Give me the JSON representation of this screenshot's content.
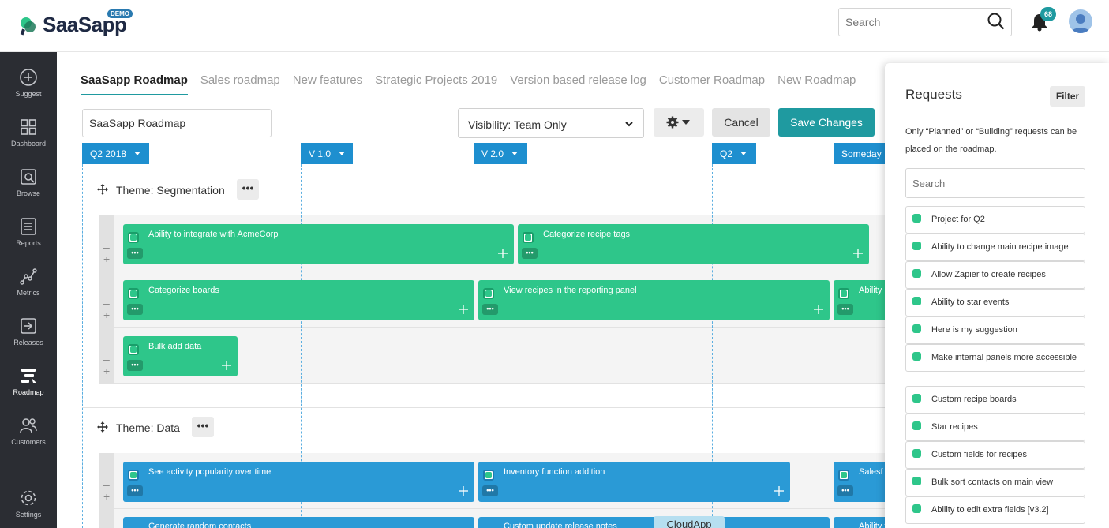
{
  "app": {
    "logo_text": "SaaSapp",
    "demo_badge": "DEMO"
  },
  "header": {
    "search_placeholder": "Search",
    "notification_count": "68"
  },
  "sidebar": {
    "items": [
      {
        "label": "Suggest",
        "icon": "plus-circle-icon"
      },
      {
        "label": "Dashboard",
        "icon": "grid-icon"
      },
      {
        "label": "Browse",
        "icon": "browse-icon"
      },
      {
        "label": "Reports",
        "icon": "reports-icon"
      },
      {
        "label": "Metrics",
        "icon": "metrics-icon"
      },
      {
        "label": "Releases",
        "icon": "releases-icon"
      },
      {
        "label": "Roadmap",
        "icon": "roadmap-icon",
        "active": true
      },
      {
        "label": "Customers",
        "icon": "customers-icon"
      },
      {
        "label": "Settings",
        "icon": "gear-icon"
      }
    ]
  },
  "tabs": [
    "SaaSapp Roadmap",
    "Sales roadmap",
    "New features",
    "Strategic Projects 2019",
    "Version based release log",
    "Customer Roadmap",
    "New Roadmap"
  ],
  "toolbar": {
    "roadmap_name": "SaaSapp Roadmap",
    "visibility": "Visibility: Team Only",
    "cancel_label": "Cancel",
    "save_label": "Save Changes"
  },
  "milestones": [
    "Q2 2018",
    "V 1.0",
    "V 2.0",
    "Q2",
    "Someday"
  ],
  "themes": [
    {
      "title": "Theme: Segmentation",
      "rows": [
        [
          "Ability to integrate with AcmeCorp",
          "Categorize recipe tags"
        ],
        [
          "Categorize boards",
          "View recipes in the reporting panel",
          "Ability"
        ],
        [
          "Bulk add data"
        ]
      ]
    },
    {
      "title": "Theme: Data",
      "rows": [
        [
          "See activity popularity over time",
          "Inventory function addition",
          "Salesf"
        ],
        [
          "Generate random contacts",
          "Custom update release notes",
          "Ability to export all recipes to CSV"
        ]
      ]
    }
  ],
  "requests_panel": {
    "title": "Requests",
    "filter_label": "Filter",
    "note": "Only “Planned” or “Building” requests can be placed on the roadmap.",
    "search_placeholder": "Search",
    "items": [
      "Project for Q2",
      "Ability to change main recipe image",
      "Allow Zapier to create recipes",
      "Ability to star events",
      "Here is my suggestion",
      "Make internal panels more accessible",
      "Custom recipe boards",
      "Star recipes",
      "Custom fields for recipes",
      "Bulk sort contacts on main view",
      "Ability to edit extra fields [v3.2]"
    ]
  },
  "drag_tooltip": "CloudApp",
  "colors": {
    "accent": "#1f9aa0",
    "milestone": "#1e8fcf",
    "card_green": "#2ec68a",
    "card_blue": "#2a9ad6",
    "sidebar": "#2b2d33"
  }
}
